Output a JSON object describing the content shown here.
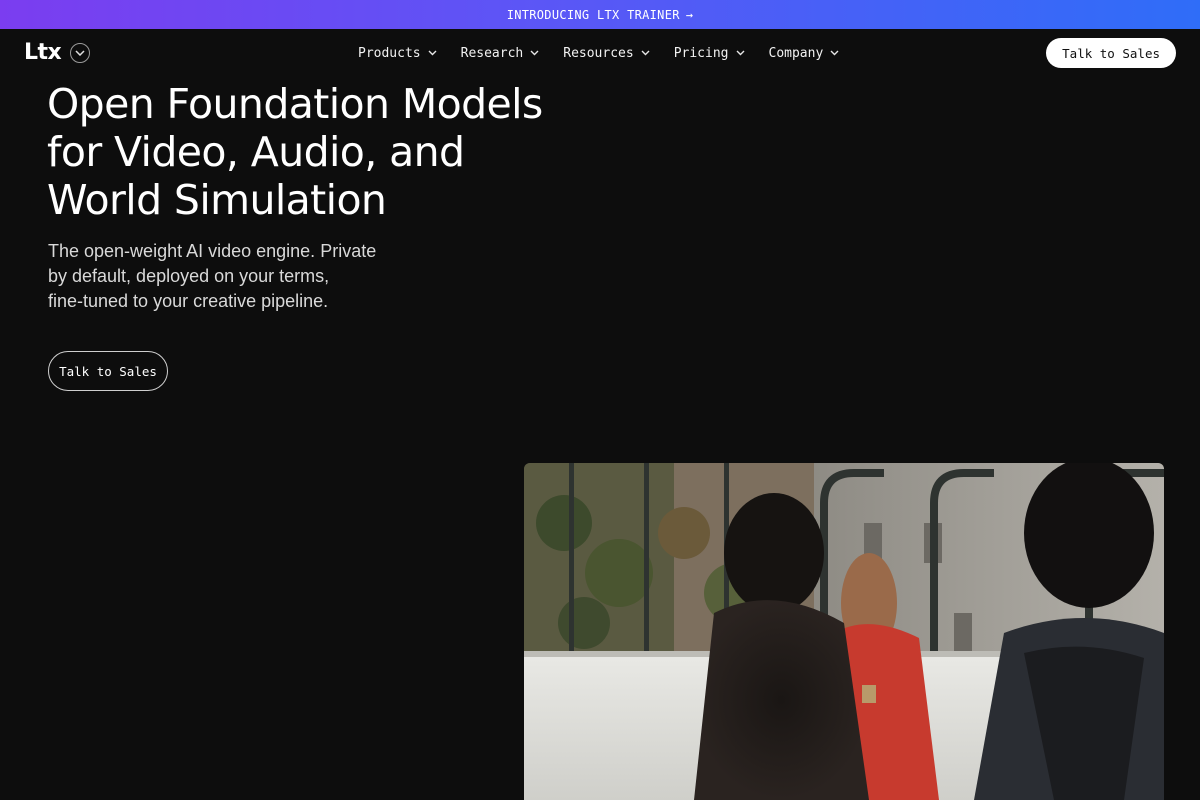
{
  "announcement": {
    "text": "INTRODUCING LTX TRAINER",
    "arrow": "→"
  },
  "nav": {
    "logo": "Ltx",
    "menu": [
      {
        "label": "Products"
      },
      {
        "label": "Research"
      },
      {
        "label": "Resources"
      },
      {
        "label": "Pricing"
      },
      {
        "label": "Company"
      }
    ],
    "cta_label": "Talk to Sales"
  },
  "hero": {
    "title_lines": [
      "Open Foundation Models",
      "for Video, Audio, and",
      "World Simulation"
    ],
    "subtitle_lines": [
      "The open-weight AI video engine. Private",
      "by default, deployed on your terms,",
      "fine-tuned to your creative pipeline."
    ],
    "cta_label": "Talk to Sales"
  },
  "colors": {
    "background": "#0d0d0d",
    "announcement_gradient_start": "#7b3df0",
    "announcement_gradient_end": "#2f6df8",
    "cta_background": "#ffffff"
  },
  "icons": {
    "announcement_arrow": "arrow-right-icon",
    "logo_toggle": "chevron-down-circle-icon",
    "menu_chevron": "chevron-down-icon"
  }
}
